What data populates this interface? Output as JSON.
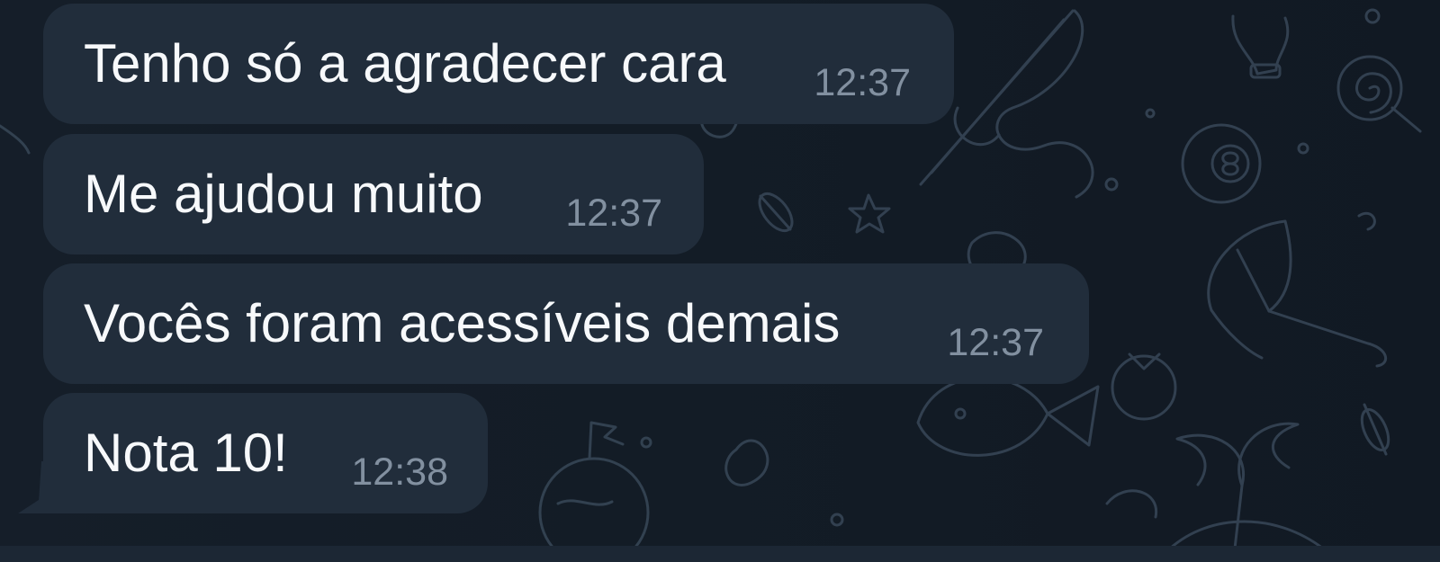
{
  "messages": [
    {
      "text": "Tenho só a agradecer cara",
      "time": "12:37"
    },
    {
      "text": "Me ajudou muito",
      "time": "12:37"
    },
    {
      "text": "Vocês foram acessíveis demais",
      "time": "12:37"
    },
    {
      "text": "Nota 10!",
      "time": "12:38"
    }
  ],
  "background": {
    "pattern": "telegram-doodle-pattern",
    "icons": [
      "fishing-rod-icon",
      "lightbulb-icon",
      "lollipop-icon",
      "billiard-ball-icon",
      "umbrella-icon",
      "palm-tree-icon",
      "candy-icon",
      "planet-flag-icon",
      "star-icon",
      "fish-icon",
      "tomato-icon"
    ]
  },
  "colors": {
    "background": "#131c26",
    "bubble": "#212d3b",
    "message_text": "#f7f9fb",
    "timestamp": "#8290a0",
    "doodle_stroke": "#344353"
  }
}
